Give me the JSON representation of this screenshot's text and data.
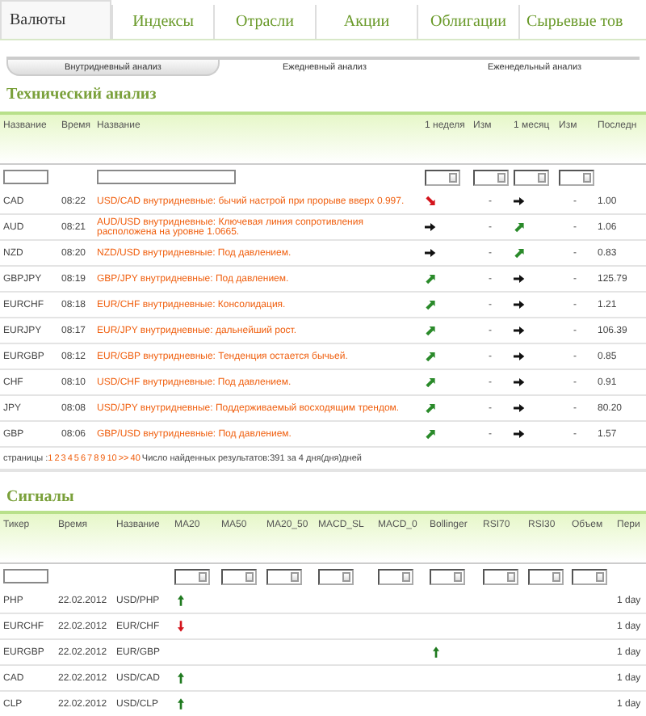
{
  "tabs": [
    {
      "label": "Валюты",
      "selected": true
    },
    {
      "label": "Индексы",
      "selected": false
    },
    {
      "label": "Отрасли",
      "selected": false
    },
    {
      "label": "Акции",
      "selected": false
    },
    {
      "label": "Облигации",
      "selected": false
    },
    {
      "label": "Сырьевые тов",
      "selected": false
    }
  ],
  "subtabs": [
    {
      "label": "Внутридневный анализ",
      "selected": true
    },
    {
      "label": "Ежедневный анализ",
      "selected": false
    },
    {
      "label": "Еженедельный анализ",
      "selected": false
    }
  ],
  "technical": {
    "title": "Технический анализ",
    "columns": [
      "Название",
      "Время",
      "Название",
      "1 неделя",
      "Изм",
      "1 месяц",
      "Изм",
      "Последн"
    ],
    "rows": [
      {
        "ticker": "CAD",
        "time": "08:22",
        "name": "USD/CAD внутридневные: бычий настрой при прорыве вверх 0.997.",
        "week": {
          "kind": "down"
        },
        "week_change": "-",
        "month": {
          "kind": "right"
        },
        "month_change": "-",
        "last": "1.00"
      },
      {
        "ticker": "AUD",
        "time": "08:21",
        "name": "AUD/USD внутридневные: Ключевая линия сопротивления расположена на уровне 1.0665.",
        "week": {
          "kind": "right"
        },
        "week_change": "-",
        "month": {
          "kind": "up"
        },
        "month_change": "-",
        "last": "1.06"
      },
      {
        "ticker": "NZD",
        "time": "08:20",
        "name": "NZD/USD внутридневные: Под давлением.",
        "week": {
          "kind": "right"
        },
        "week_change": "-",
        "month": {
          "kind": "up"
        },
        "month_change": "-",
        "last": "0.83"
      },
      {
        "ticker": "GBPJPY",
        "time": "08:19",
        "name": "GBP/JPY внутридневные: Под давлением.",
        "week": {
          "kind": "up"
        },
        "week_change": "-",
        "month": {
          "kind": "right"
        },
        "month_change": "-",
        "last": "125.79"
      },
      {
        "ticker": "EURCHF",
        "time": "08:18",
        "name": "EUR/CHF внутридневные: Консолидация.",
        "week": {
          "kind": "up"
        },
        "week_change": "-",
        "month": {
          "kind": "right"
        },
        "month_change": "-",
        "last": "1.21"
      },
      {
        "ticker": "EURJPY",
        "time": "08:17",
        "name": "EUR/JPY внутридневные: дальнейший рост.",
        "week": {
          "kind": "up"
        },
        "week_change": "-",
        "month": {
          "kind": "right"
        },
        "month_change": "-",
        "last": "106.39"
      },
      {
        "ticker": "EURGBP",
        "time": "08:12",
        "name": "EUR/GBP внутридневные: Тенденция остается бычьей.",
        "week": {
          "kind": "up"
        },
        "week_change": "-",
        "month": {
          "kind": "right"
        },
        "month_change": "-",
        "last": "0.85"
      },
      {
        "ticker": "CHF",
        "time": "08:10",
        "name": "USD/CHF внутридневные: Под давлением.",
        "week": {
          "kind": "up"
        },
        "week_change": "-",
        "month": {
          "kind": "right"
        },
        "month_change": "-",
        "last": "0.91"
      },
      {
        "ticker": "JPY",
        "time": "08:08",
        "name": "USD/JPY внутридневные: Поддерживаемый восходящим трендом.",
        "week": {
          "kind": "up"
        },
        "week_change": "-",
        "month": {
          "kind": "right"
        },
        "month_change": "-",
        "last": "80.20"
      },
      {
        "ticker": "GBP",
        "time": "08:06",
        "name": "GBP/USD внутридневные: Под давлением.",
        "week": {
          "kind": "up"
        },
        "week_change": "-",
        "month": {
          "kind": "right"
        },
        "month_change": "-",
        "last": "1.57"
      }
    ],
    "pager": {
      "label": "страницы :",
      "pages": [
        "1",
        "2",
        "3",
        "4",
        "5",
        "6",
        "7",
        "8",
        "9",
        "10",
        ">>",
        "40"
      ],
      "summary": "Число найденных результатов:391 за 4 дня(дня)дней"
    }
  },
  "signals": {
    "title": "Сигналы",
    "columns": [
      "Тикер",
      "Время",
      "Название",
      "MA20",
      "MA50",
      "MA20_50",
      "MACD_SL",
      "MACD_0",
      "Bollinger",
      "RSI70",
      "RSI30",
      "Объем",
      "Пери"
    ],
    "rows": [
      {
        "ticker": "PHP",
        "time": "22.02.2012",
        "name": "USD/PHP",
        "indicators": [
          {
            "kind": "up"
          },
          {
            "kind": "none"
          },
          {
            "kind": "none"
          },
          {
            "kind": "none"
          },
          {
            "kind": "none"
          },
          {
            "kind": "none"
          },
          {
            "kind": "none"
          },
          {
            "kind": "none"
          },
          {
            "kind": "none"
          }
        ],
        "period": "1 day"
      },
      {
        "ticker": "EURCHF",
        "time": "22.02.2012",
        "name": "EUR/CHF",
        "indicators": [
          {
            "kind": "down"
          },
          {
            "kind": "none"
          },
          {
            "kind": "none"
          },
          {
            "kind": "none"
          },
          {
            "kind": "none"
          },
          {
            "kind": "none"
          },
          {
            "kind": "none"
          },
          {
            "kind": "none"
          },
          {
            "kind": "none"
          }
        ],
        "period": "1 day"
      },
      {
        "ticker": "EURGBP",
        "time": "22.02.2012",
        "name": "EUR/GBP",
        "indicators": [
          {
            "kind": "none"
          },
          {
            "kind": "none"
          },
          {
            "kind": "none"
          },
          {
            "kind": "none"
          },
          {
            "kind": "none"
          },
          {
            "kind": "up"
          },
          {
            "kind": "none"
          },
          {
            "kind": "none"
          },
          {
            "kind": "none"
          }
        ],
        "period": "1 day"
      },
      {
        "ticker": "CAD",
        "time": "22.02.2012",
        "name": "USD/CAD",
        "indicators": [
          {
            "kind": "up"
          },
          {
            "kind": "none"
          },
          {
            "kind": "none"
          },
          {
            "kind": "none"
          },
          {
            "kind": "none"
          },
          {
            "kind": "none"
          },
          {
            "kind": "none"
          },
          {
            "kind": "none"
          },
          {
            "kind": "none"
          }
        ],
        "period": "1 day"
      },
      {
        "ticker": "CLP",
        "time": "22.02.2012",
        "name": "USD/CLP",
        "indicators": [
          {
            "kind": "up"
          },
          {
            "kind": "none"
          },
          {
            "kind": "none"
          },
          {
            "kind": "none"
          },
          {
            "kind": "none"
          },
          {
            "kind": "none"
          },
          {
            "kind": "none"
          },
          {
            "kind": "none"
          },
          {
            "kind": "none"
          }
        ],
        "period": "1 day"
      }
    ]
  }
}
